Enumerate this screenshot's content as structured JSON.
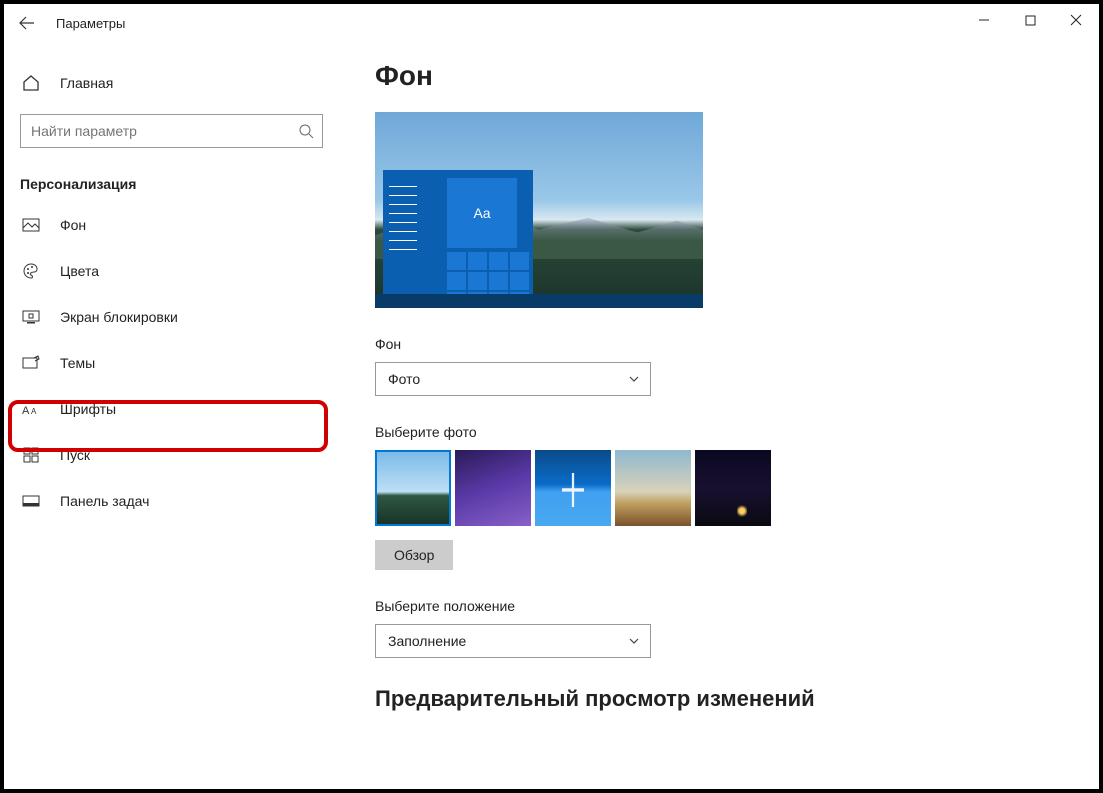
{
  "titlebar": {
    "title": "Параметры"
  },
  "sidebar": {
    "home": "Главная",
    "search_placeholder": "Найти параметр",
    "section": "Персонализация",
    "items": [
      {
        "label": "Фон"
      },
      {
        "label": "Цвета"
      },
      {
        "label": "Экран блокировки"
      },
      {
        "label": "Темы"
      },
      {
        "label": "Шрифты"
      },
      {
        "label": "Пуск"
      },
      {
        "label": "Панель задач"
      }
    ]
  },
  "content": {
    "heading": "Фон",
    "preview_tile_text": "Aa",
    "background_label": "Фон",
    "background_dropdown": "Фото",
    "choose_photo_label": "Выберите фото",
    "browse": "Обзор",
    "fit_label": "Выберите положение",
    "fit_dropdown": "Заполнение",
    "subheading": "Предварительный просмотр изменений"
  }
}
